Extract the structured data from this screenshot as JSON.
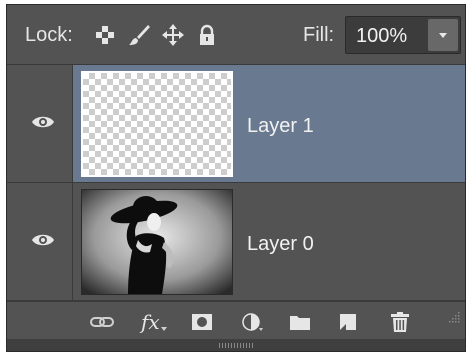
{
  "header": {
    "lock_label": "Lock:",
    "lock_icons": [
      "lock-transparent-pixels-icon",
      "lock-image-pixels-icon",
      "lock-position-icon",
      "lock-all-icon"
    ],
    "fill_label": "Fill:",
    "fill_value": "100%"
  },
  "layers": [
    {
      "name": "Layer 1",
      "selected": true,
      "visible": true,
      "thumbnail": "transparent"
    },
    {
      "name": "Layer 0",
      "selected": false,
      "visible": true,
      "thumbnail": "photo"
    }
  ],
  "footer": {
    "icons": [
      "link-layers-icon",
      "fx-icon",
      "add-mask-icon",
      "adjustment-layer-icon",
      "new-group-icon",
      "new-layer-icon",
      "trash-icon"
    ],
    "fx_text": "fx"
  },
  "colors": {
    "panel_bg": "#535353",
    "selected_row": "#69798f",
    "text": "#f2f2f2"
  }
}
